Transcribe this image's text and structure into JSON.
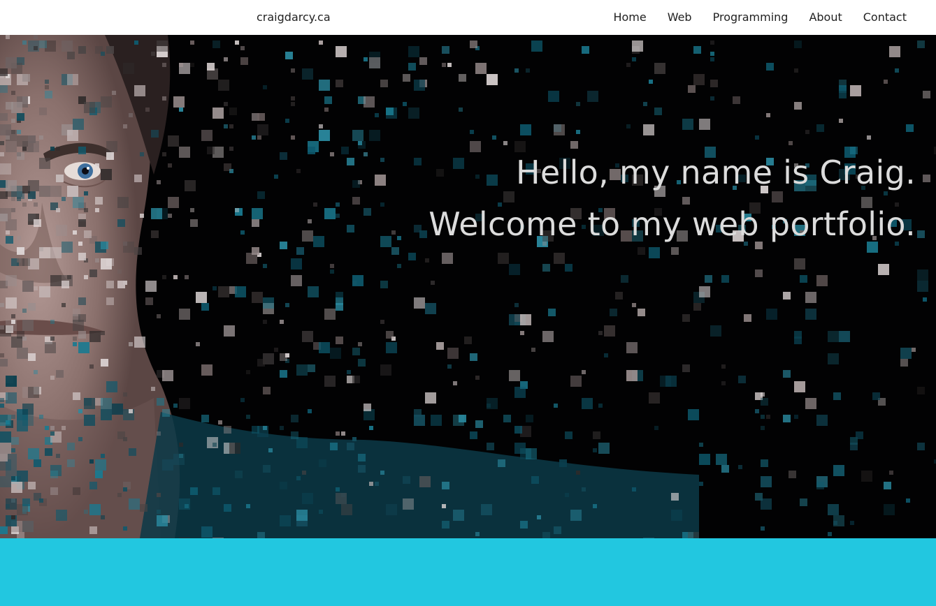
{
  "site": {
    "brand": "craigdarcy.ca"
  },
  "nav": {
    "items": [
      {
        "label": "Home"
      },
      {
        "label": "Web"
      },
      {
        "label": "Programming"
      },
      {
        "label": "About"
      },
      {
        "label": "Contact"
      }
    ]
  },
  "hero": {
    "line1": "Hello, my name is Craig.",
    "line2": "Welcome to my web portfolio.",
    "image_icon": "pixelated-portrait-image"
  },
  "colors": {
    "nav_bg": "#ffffff",
    "hero_bg": "#020203",
    "hero_text": "#dcdcdc",
    "accent_band": "#22c7e0"
  }
}
